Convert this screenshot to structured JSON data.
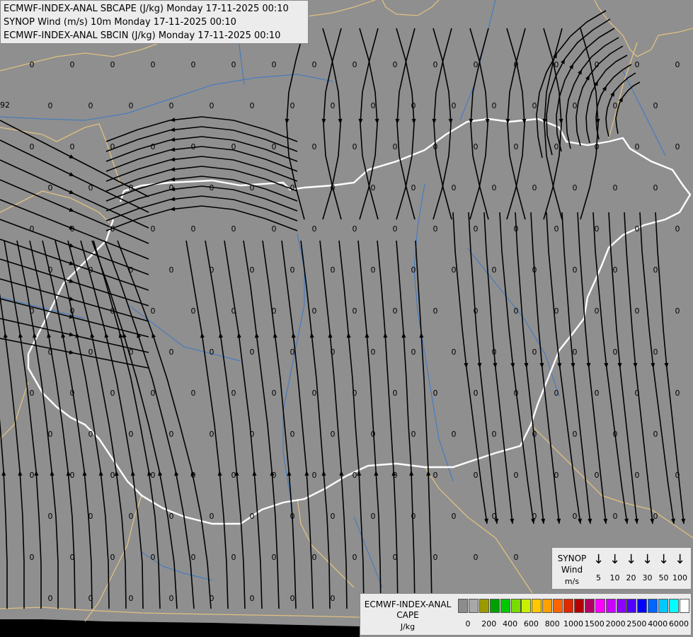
{
  "titles": {
    "line1": "ECMWF-INDEX-ANAL SBCAPE (J/kg) Monday 17-11-2025 00:10",
    "line2": "SYNOP Wind (m/s) 10m Monday 17-11-2025 00:10",
    "line3": "ECMWF-INDEX-ANAL SBCIN (J/kg) Monday 17-11-2025 00:10"
  },
  "map_values": {
    "zero": "0",
    "edge_value": "92"
  },
  "wind_legend": {
    "title_line1": "SYNOP",
    "title_line2": "Wind",
    "unit": "m/s",
    "speeds": [
      "5",
      "10",
      "20",
      "30",
      "50",
      "100"
    ]
  },
  "cape_legend": {
    "title_line1": "ECMWF-INDEX-ANAL",
    "title_line2": "CAPE",
    "unit": "J/kg",
    "ticks": [
      "0",
      "200",
      "400",
      "600",
      "800",
      "1000",
      "1500",
      "2000",
      "2500",
      "4000",
      "6000"
    ],
    "colors": [
      "#8c8c8c",
      "#a8a8a8",
      "#9a9a00",
      "#00a000",
      "#00c800",
      "#78dc00",
      "#c8f000",
      "#ffc800",
      "#ffa000",
      "#ff6400",
      "#e02800",
      "#b40000",
      "#b40064",
      "#ff00ff",
      "#c800ff",
      "#8c00ff",
      "#5000ff",
      "#0000ff",
      "#0064ff",
      "#00c8ff",
      "#00ffff",
      "#ffffff"
    ]
  },
  "colors": {
    "background": "#8f8f8f",
    "water": "#3a78c8",
    "country_border": "#e0c080",
    "hungary_border": "#ffffff",
    "streamline": "#000000"
  }
}
